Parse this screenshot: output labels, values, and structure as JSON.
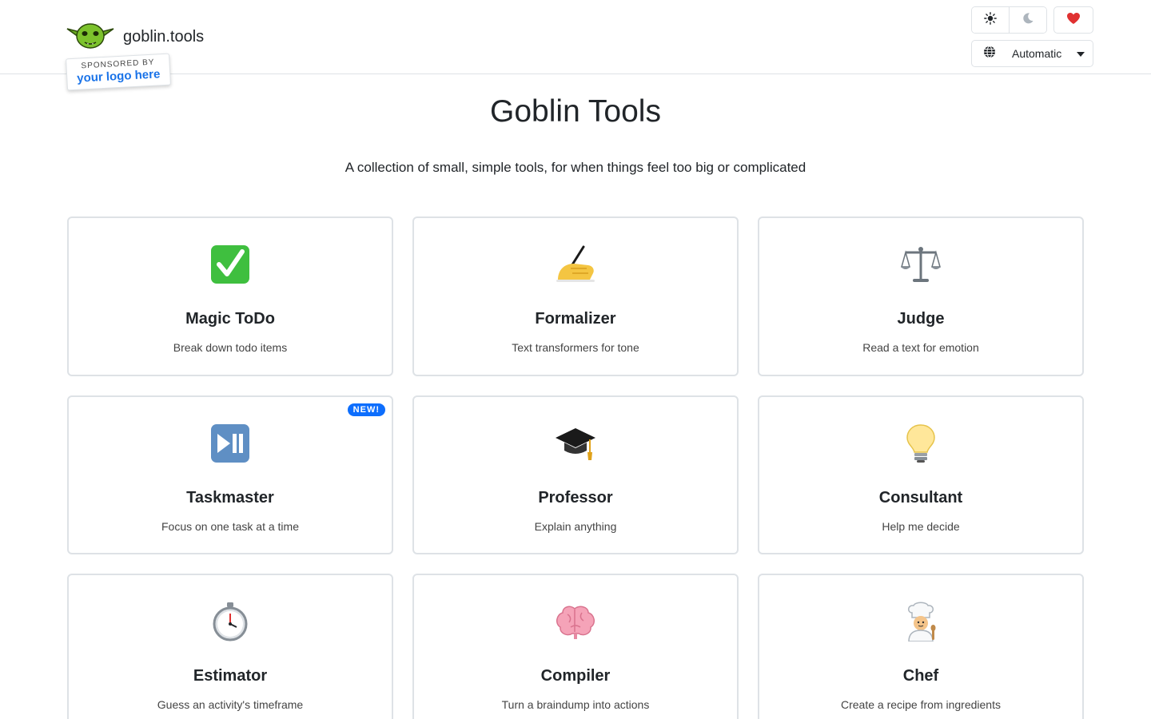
{
  "header": {
    "brand_name": "goblin.tools",
    "sponsor_top": "SPONSORED BY",
    "sponsor_main": "your logo here",
    "theme_light_icon": "sun-icon",
    "theme_dark_icon": "moon-icon",
    "support_icon": "heart-icon",
    "language_icon": "globe-icon",
    "language_value": "Automatic"
  },
  "page": {
    "title": "Goblin Tools",
    "subtitle": "A collection of small, simple tools, for when things feel too big or complicated"
  },
  "tools": [
    {
      "name": "Magic ToDo",
      "desc": "Break down todo items",
      "icon": "check-mark-icon"
    },
    {
      "name": "Formalizer",
      "desc": "Text transformers for tone",
      "icon": "writing-hand-icon"
    },
    {
      "name": "Judge",
      "desc": "Read a text for emotion",
      "icon": "balance-scale-icon"
    },
    {
      "name": "Taskmaster",
      "desc": "Focus on one task at a time",
      "icon": "play-pause-icon",
      "badge": "NEW!"
    },
    {
      "name": "Professor",
      "desc": "Explain anything",
      "icon": "graduation-cap-icon"
    },
    {
      "name": "Consultant",
      "desc": "Help me decide",
      "icon": "light-bulb-icon"
    },
    {
      "name": "Estimator",
      "desc": "Guess an activity's timeframe",
      "icon": "stopwatch-icon"
    },
    {
      "name": "Compiler",
      "desc": "Turn a braindump into actions",
      "icon": "brain-icon"
    },
    {
      "name": "Chef",
      "desc": "Create a recipe from ingredients",
      "icon": "chef-icon"
    }
  ],
  "colors": {
    "accent": "#0d6efd",
    "border": "#dee2e6",
    "heart": "#e03131",
    "goblin_green": "#7cc22c"
  }
}
